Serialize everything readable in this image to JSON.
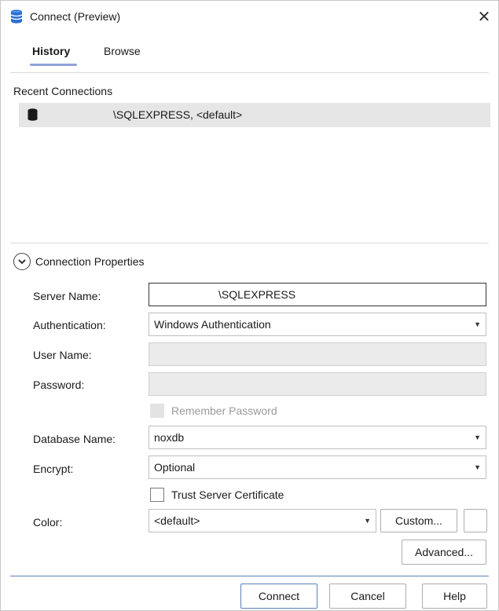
{
  "window": {
    "title": "Connect (Preview)",
    "close_glyph": "✕",
    "app_icon": "database-stack-icon"
  },
  "tabs": [
    {
      "label": "History",
      "selected": true
    },
    {
      "label": "Browse",
      "selected": false
    }
  ],
  "recent": {
    "header": "Recent Connections",
    "items": [
      {
        "text": "\\SQLEXPRESS, <default>",
        "icon": "database-icon"
      }
    ]
  },
  "properties": {
    "title": "Connection Properties",
    "server_name": {
      "label": "Server Name:",
      "value": "\\SQLEXPRESS"
    },
    "authentication": {
      "label": "Authentication:",
      "value": "Windows Authentication"
    },
    "user_name": {
      "label": "User Name:",
      "value": ""
    },
    "password": {
      "label": "Password:",
      "value": ""
    },
    "remember_password": {
      "label": "Remember Password",
      "checked": false,
      "enabled": false
    },
    "database_name": {
      "label": "Database Name:",
      "value": "noxdb"
    },
    "encrypt": {
      "label": "Encrypt:",
      "value": "Optional"
    },
    "trust_cert": {
      "label": "Trust Server Certificate",
      "checked": false
    },
    "color": {
      "label": "Color:",
      "value": "<default>",
      "custom_label": "Custom..."
    },
    "advanced_label": "Advanced..."
  },
  "footer": {
    "connect_label": "Connect",
    "cancel_label": "Cancel",
    "help_label": "Help"
  },
  "colors": {
    "accent": "#5b7fb6",
    "tab_underline": "#8ea2d8",
    "selected_row": "#e6e6e6",
    "disabled_field": "#ebebeb"
  }
}
